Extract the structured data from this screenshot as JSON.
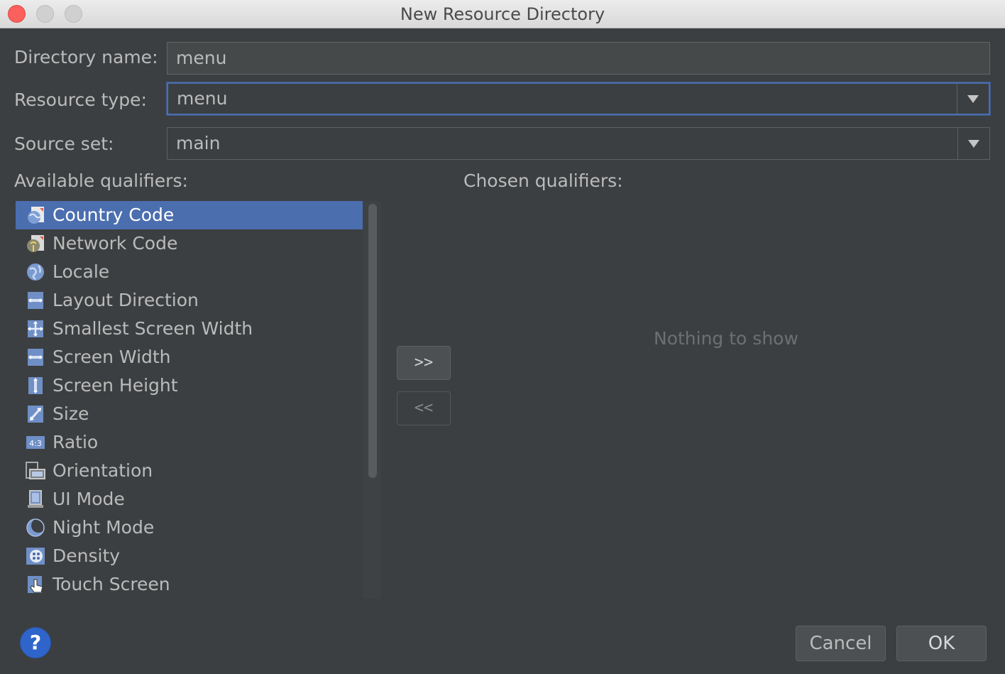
{
  "window": {
    "title": "New Resource Directory"
  },
  "form": {
    "directory_name_label": "Directory name:",
    "directory_name_value": "menu",
    "resource_type_label": "Resource type:",
    "resource_type_value": "menu",
    "source_set_label": "Source set:",
    "source_set_value": "main"
  },
  "qualifiers": {
    "available_label": "Available qualifiers:",
    "chosen_label": "Chosen qualifiers:",
    "available": [
      {
        "label": "Country Code",
        "icon": "country-code-icon",
        "selected": true
      },
      {
        "label": "Network Code",
        "icon": "network-code-icon",
        "selected": false
      },
      {
        "label": "Locale",
        "icon": "globe-icon",
        "selected": false
      },
      {
        "label": "Layout Direction",
        "icon": "layout-direction-icon",
        "selected": false
      },
      {
        "label": "Smallest Screen Width",
        "icon": "smallest-screen-width-icon",
        "selected": false
      },
      {
        "label": "Screen Width",
        "icon": "screen-width-icon",
        "selected": false
      },
      {
        "label": "Screen Height",
        "icon": "screen-height-icon",
        "selected": false
      },
      {
        "label": "Size",
        "icon": "size-icon",
        "selected": false
      },
      {
        "label": "Ratio",
        "icon": "ratio-icon",
        "selected": false
      },
      {
        "label": "Orientation",
        "icon": "orientation-icon",
        "selected": false
      },
      {
        "label": "UI Mode",
        "icon": "ui-mode-icon",
        "selected": false
      },
      {
        "label": "Night Mode",
        "icon": "night-mode-icon",
        "selected": false
      },
      {
        "label": "Density",
        "icon": "density-icon",
        "selected": false
      },
      {
        "label": "Touch Screen",
        "icon": "touch-screen-icon",
        "selected": false
      }
    ],
    "add_button": ">>",
    "remove_button": "<<",
    "empty_text": "Nothing to show"
  },
  "buttons": {
    "help": "?",
    "cancel": "Cancel",
    "ok": "OK"
  },
  "colors": {
    "background": "#3c3f41",
    "selection": "#4b6eaf",
    "focus_border": "#4b6eaf",
    "help_blue": "#2f65ca"
  }
}
